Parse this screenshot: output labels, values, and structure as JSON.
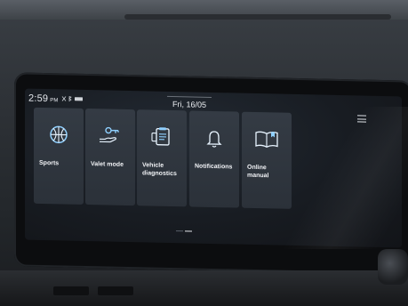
{
  "status": {
    "time": "2:59",
    "ampm": "PM",
    "icons": "no-signal bluetooth battery",
    "date": "Fri, 16/05"
  },
  "tiles": [
    {
      "label": "Sports",
      "icon": "sports-ball-icon"
    },
    {
      "label": "Valet mode",
      "icon": "valet-hand-key-icon"
    },
    {
      "label": "Vehicle diagnostics",
      "icon": "diagnostics-clipboard-icon"
    },
    {
      "label": "Notifications",
      "icon": "bell-icon"
    },
    {
      "label": "Online manual",
      "icon": "book-icon"
    }
  ],
  "colors": {
    "tile_bg": "#343b44",
    "icon_accent": "#8fd0ff",
    "text": "#f1f3f6"
  },
  "pager": {
    "pages": 2,
    "active": 2
  }
}
